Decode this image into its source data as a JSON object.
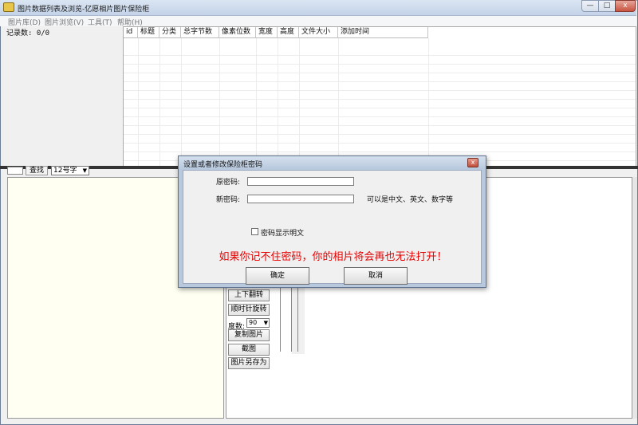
{
  "window": {
    "title": "图片数据列表及浏览-亿愿相片图片保险柜",
    "min_label": "—",
    "max_label": "□",
    "close_label": "x"
  },
  "menu": [
    {
      "label": "图片库(D)"
    },
    {
      "label": "图片浏览(V)"
    },
    {
      "label": "工具(T)"
    },
    {
      "label": "帮助(H)"
    }
  ],
  "left_pane": {
    "record_count": "记录数: 0/0"
  },
  "list": {
    "columns": [
      "id",
      "标题",
      "分类",
      "总字节数",
      "像素位数",
      "宽度",
      "高度",
      "文件大小",
      "添加时间"
    ]
  },
  "toolbar": {
    "find_label": "查找",
    "font_size_value": "12号字"
  },
  "tools": {
    "flip_vertical": "上下翻转",
    "rotate_clockwise": "顺时针旋转",
    "degrees_label": "度数:",
    "degrees_value": "90",
    "copy_image": "复制图片",
    "screenshot": "截图",
    "save_image_as": "图片另存为"
  },
  "dialog": {
    "title": "设置或者修改保险柜密码",
    "close_label": "x",
    "old_password_label": "原密码:",
    "new_password_label": "新密码:",
    "new_password_hint": "可以是中文、英文、数字等",
    "show_plain_label": "密码显示明文",
    "warning": "如果你记不住密码，你的相片将会再也无法打开！",
    "ok_label": "确定",
    "cancel_label": "取消"
  },
  "colors": {
    "warning_text": "#e60000"
  }
}
